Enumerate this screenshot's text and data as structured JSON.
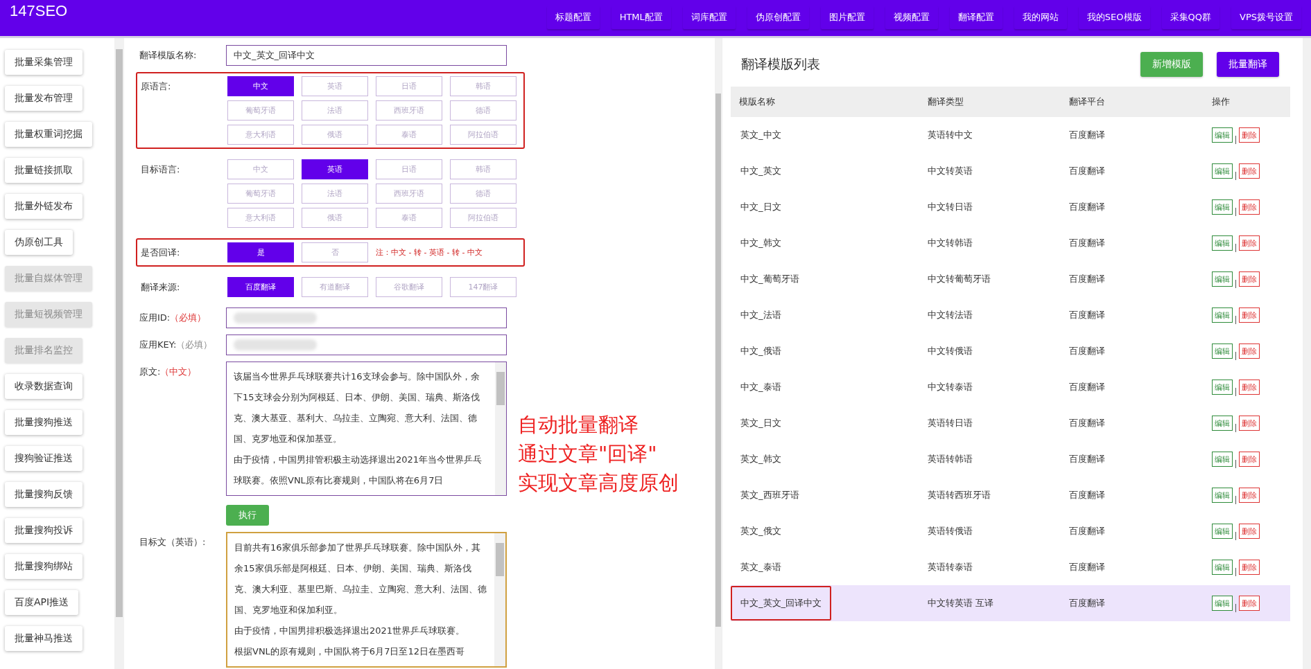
{
  "topbar": {
    "logo": "147SEO",
    "menu": [
      "标题配置",
      "HTML配置",
      "词库配置",
      "伪原创配置",
      "图片配置",
      "视频配置",
      "翻译配置",
      "我的网站",
      "我的SEO模版",
      "采集QQ群",
      "VPS拨号设置"
    ]
  },
  "sidebar": {
    "items": [
      {
        "label": "批量采集管理",
        "disabled": false
      },
      {
        "label": "批量发布管理",
        "disabled": false
      },
      {
        "label": "批量权重词挖掘",
        "disabled": false
      },
      {
        "label": "批量链接抓取",
        "disabled": false
      },
      {
        "label": "批量外链发布",
        "disabled": false
      },
      {
        "label": "伪原创工具",
        "disabled": false
      },
      {
        "label": "批量自媒体管理",
        "disabled": true
      },
      {
        "label": "批量短视频管理",
        "disabled": true
      },
      {
        "label": "批量排名监控",
        "disabled": true
      },
      {
        "label": "收录数据查询",
        "disabled": false
      },
      {
        "label": "批量搜狗推送",
        "disabled": false
      },
      {
        "label": "搜狗验证推送",
        "disabled": false
      },
      {
        "label": "批量搜狗反馈",
        "disabled": false
      },
      {
        "label": "批量搜狗投诉",
        "disabled": false
      },
      {
        "label": "批量搜狗绑站",
        "disabled": false
      },
      {
        "label": "百度API推送",
        "disabled": false
      },
      {
        "label": "批量神马推送",
        "disabled": false
      }
    ]
  },
  "form": {
    "name": {
      "label": "翻译模版名称:",
      "value": "中文_英文_回译中文"
    },
    "option_groups": [
      {
        "label": "原语言:",
        "highlighted": true,
        "options": [
          {
            "label": "中文",
            "selected": true
          },
          {
            "label": "英语",
            "selected": false
          },
          {
            "label": "日语",
            "selected": false
          },
          {
            "label": "韩语",
            "selected": false
          },
          {
            "label": "葡萄牙语",
            "selected": false
          },
          {
            "label": "法语",
            "selected": false
          },
          {
            "label": "西班牙语",
            "selected": false
          },
          {
            "label": "德语",
            "selected": false
          },
          {
            "label": "意大利语",
            "selected": false
          },
          {
            "label": "俄语",
            "selected": false
          },
          {
            "label": "泰语",
            "selected": false
          },
          {
            "label": "阿拉伯语",
            "selected": false
          }
        ]
      },
      {
        "label": "目标语言:",
        "highlighted": false,
        "options": [
          {
            "label": "中文",
            "selected": false
          },
          {
            "label": "英语",
            "selected": true
          },
          {
            "label": "日语",
            "selected": false
          },
          {
            "label": "韩语",
            "selected": false
          },
          {
            "label": "葡萄牙语",
            "selected": false
          },
          {
            "label": "法语",
            "selected": false
          },
          {
            "label": "西班牙语",
            "selected": false
          },
          {
            "label": "德语",
            "selected": false
          },
          {
            "label": "意大利语",
            "selected": false
          },
          {
            "label": "俄语",
            "selected": false
          },
          {
            "label": "泰语",
            "selected": false
          },
          {
            "label": "阿拉伯语",
            "selected": false
          }
        ]
      },
      {
        "label": "是否回译:",
        "highlighted": true,
        "note": "注：中文 - 转 - 英语 - 转 - 中文",
        "options": [
          {
            "label": "是",
            "selected": true
          },
          {
            "label": "否",
            "selected": false
          }
        ]
      },
      {
        "label": "翻译来源:",
        "highlighted": false,
        "options": [
          {
            "label": "百度翻译",
            "selected": true
          },
          {
            "label": "有道翻译",
            "selected": false
          },
          {
            "label": "谷歌翻译",
            "selected": false
          },
          {
            "label": "147翻译",
            "selected": false
          }
        ]
      }
    ],
    "credentials": [
      {
        "label": "应用ID:",
        "note": "（必填）",
        "emphasized": true
      },
      {
        "label": "应用KEY:",
        "note": "（必填）",
        "emphasized": false
      }
    ],
    "source_text": {
      "label": "原文:",
      "note": "（中文）",
      "paragraphs": [
        "该届当今世界乒乓球联赛共计16支球会参与。除中国队外，余下15支球会分别为阿根廷、日本、伊朗、美国、瑞典、斯洛伐克、澳大基亚、基利大、乌拉圭、立陶宛、意大利、法国、德国、克罗地亚和保加基亚。",
        "由于疫情，中国男排管积极主动选择退出2021年当今世界乒乓球联赛。依照VNL原有比赛规则，中国队将在6月7日"
      ]
    },
    "run_button": "执行",
    "target_text": {
      "label": "目标文（英语）:",
      "paragraphs": [
        "目前共有16家俱乐部参加了世界乒乓球联赛。除中国队外，其余15家俱乐部是阿根廷、日本、伊朗、美国、瑞典、斯洛伐克、澳大利亚、基里巴斯、乌拉圭、立陶宛、意大利、法国、德国、克罗地亚和保加利亚。",
        "由于疫情，中国男排积极选择退出2021世界乒乓球联赛。",
        "根据VNL的原有规则，中国队将于6月7日至12日在墨西哥"
      ]
    }
  },
  "annotation": {
    "lines": [
      "自动批量翻译",
      "通过文章\"回译\"",
      "实现文章高度原创"
    ]
  },
  "template_list": {
    "title": "翻译模版列表",
    "buttons": [
      {
        "label": "新增模版",
        "kind": "add"
      },
      {
        "label": "批量翻译",
        "kind": "batch"
      }
    ],
    "columns": [
      "模版名称",
      "翻译类型",
      "翻译平台",
      "操作"
    ],
    "rows": [
      {
        "name": "英文_中文",
        "type": "英语转中文",
        "platform": "百度翻译",
        "edit": "编辑",
        "delete": "删除",
        "selected": false
      },
      {
        "name": "中文_英文",
        "type": "中文转英语",
        "platform": "百度翻译",
        "edit": "编辑",
        "delete": "删除",
        "selected": false
      },
      {
        "name": "中文_日文",
        "type": "中文转日语",
        "platform": "百度翻译",
        "edit": "编辑",
        "delete": "删除",
        "selected": false
      },
      {
        "name": "中文_韩文",
        "type": "中文转韩语",
        "platform": "百度翻译",
        "edit": "编辑",
        "delete": "删除",
        "selected": false
      },
      {
        "name": "中文_葡萄牙语",
        "type": "中文转葡萄牙语",
        "platform": "百度翻译",
        "edit": "编辑",
        "delete": "删除",
        "selected": false
      },
      {
        "name": "中文_法语",
        "type": "中文转法语",
        "platform": "百度翻译",
        "edit": "编辑",
        "delete": "删除",
        "selected": false
      },
      {
        "name": "中文_俄语",
        "type": "中文转俄语",
        "platform": "百度翻译",
        "edit": "编辑",
        "delete": "删除",
        "selected": false
      },
      {
        "name": "中文_泰语",
        "type": "中文转泰语",
        "platform": "百度翻译",
        "edit": "编辑",
        "delete": "删除",
        "selected": false
      },
      {
        "name": "英文_日文",
        "type": "英语转日语",
        "platform": "百度翻译",
        "edit": "编辑",
        "delete": "删除",
        "selected": false
      },
      {
        "name": "英文_韩文",
        "type": "英语转韩语",
        "platform": "百度翻译",
        "edit": "编辑",
        "delete": "删除",
        "selected": false
      },
      {
        "name": "英文_西班牙语",
        "type": "英语转西班牙语",
        "platform": "百度翻译",
        "edit": "编辑",
        "delete": "删除",
        "selected": false
      },
      {
        "name": "英文_俄文",
        "type": "英语转俄语",
        "platform": "百度翻译",
        "edit": "编辑",
        "delete": "删除",
        "selected": false
      },
      {
        "name": "英文_泰语",
        "type": "英语转泰语",
        "platform": "百度翻译",
        "edit": "编辑",
        "delete": "删除",
        "selected": false
      },
      {
        "name": "中文_英文_回译中文",
        "type": "中文转英语 互译",
        "platform": "百度翻译",
        "edit": "编辑",
        "delete": "删除",
        "selected": true
      }
    ]
  }
}
